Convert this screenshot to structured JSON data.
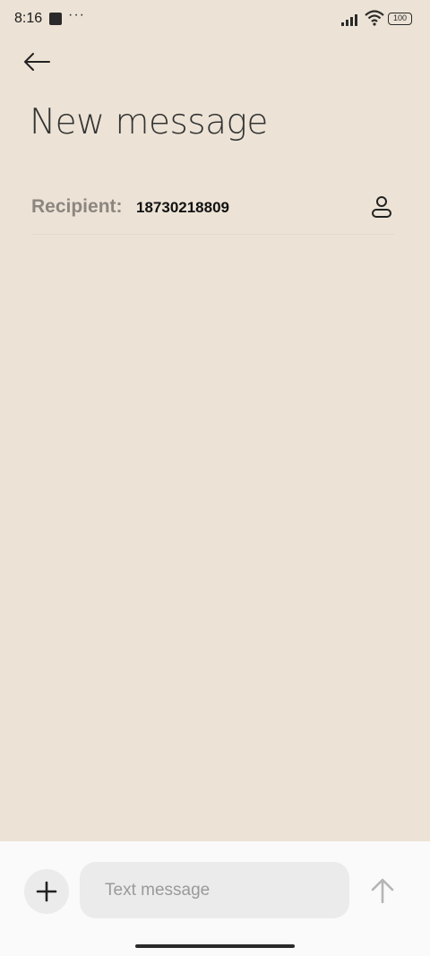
{
  "status_bar": {
    "time": "8:16",
    "dots": "···",
    "battery": "100"
  },
  "header": {
    "title": "New message"
  },
  "recipient": {
    "label": "Recipient:",
    "value": "18730218809"
  },
  "compose": {
    "placeholder": "Text message"
  },
  "colors": {
    "background": "#ece3d6",
    "compose_bar": "#fafafa",
    "muted_label": "#8c8680"
  }
}
